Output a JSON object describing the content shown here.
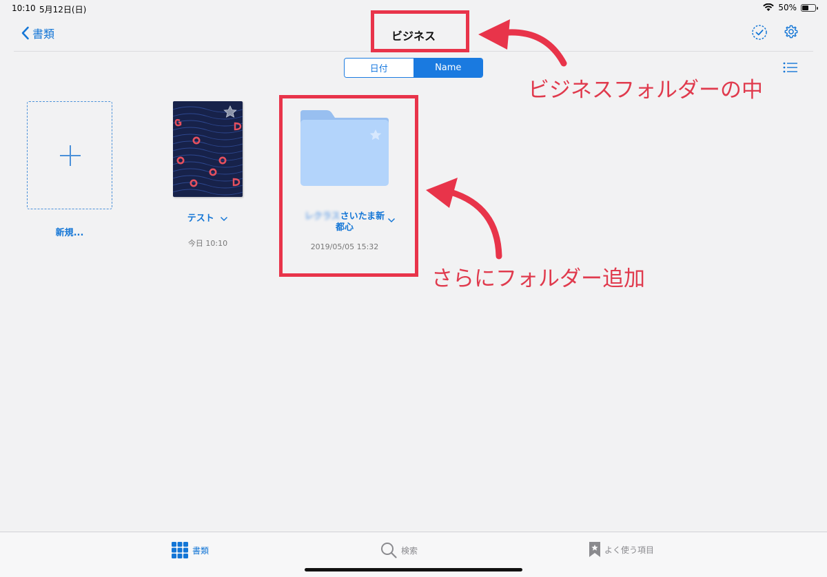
{
  "status": {
    "time": "10:10",
    "date": "5月12日(日)",
    "battery_text": "50%",
    "battery_level": 0.5
  },
  "nav": {
    "back_label": "書類",
    "title": "ビジネス"
  },
  "sort": {
    "options": [
      "日付",
      "Name"
    ],
    "selected": "Name"
  },
  "items": {
    "new_label": "新規...",
    "doc": {
      "name": "テスト",
      "date": "今日 10:10"
    },
    "folder": {
      "name_blurred": "レクラス",
      "name_line1": "さいたま新",
      "name_line2": "都心",
      "date": "2019/05/05 15:32"
    }
  },
  "annotations": {
    "title_note": "ビジネスフォルダーの中",
    "folder_note": "さらにフォルダー追加"
  },
  "tabs": [
    {
      "label": "書類",
      "icon": "grid-icon",
      "active": true
    },
    {
      "label": "検索",
      "icon": "search-icon",
      "active": false
    },
    {
      "label": "よく使う項目",
      "icon": "bookmark-icon",
      "active": false
    }
  ],
  "colors": {
    "accent": "#1a7ae0",
    "annotation": "#e8344a",
    "folder": "#b3d4fb"
  }
}
